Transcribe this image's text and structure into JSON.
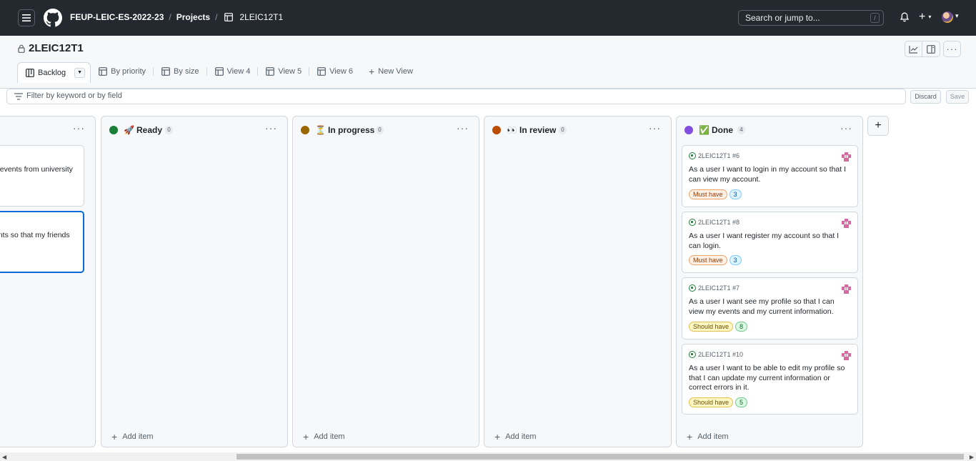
{
  "header": {
    "org": "FEUP-LEIC-ES-2022-23",
    "projects": "Projects",
    "project": "2LEIC12T1",
    "search_placeholder": "Search or jump to...",
    "search_shortcut": "/"
  },
  "project": {
    "title": "2LEIC12T1"
  },
  "tabs": [
    {
      "label": "Backlog"
    },
    {
      "label": "By priority"
    },
    {
      "label": "By size"
    },
    {
      "label": "View 4"
    },
    {
      "label": "View 5"
    },
    {
      "label": "View 6"
    },
    {
      "label": "New View"
    }
  ],
  "filter": {
    "placeholder": "Filter by keyword or by field",
    "discard": "Discard",
    "save": "Save"
  },
  "partial_column": {
    "cards": [
      {
        "title": "e events from university\nd."
      },
      {
        "title": "ents so that my friends"
      }
    ]
  },
  "columns": [
    {
      "name": "Ready",
      "count": "0",
      "color": "#1a7f37",
      "emoji": "🚀",
      "add_label": "Add item"
    },
    {
      "name": "In progress",
      "count": "0",
      "color": "#9a6700",
      "emoji": "⏳",
      "add_label": "Add item"
    },
    {
      "name": "In review",
      "count": "0",
      "color": "#bc4c00",
      "emoji": "👀",
      "add_label": "Add item"
    },
    {
      "name": "Done",
      "count": "4",
      "color": "#8250df",
      "emoji": "✅",
      "add_label": "Add item"
    }
  ],
  "done_cards": [
    {
      "ref": "2LEIC12T1 #6",
      "title": "As a user I want to login in my account so that I can view my account.",
      "priority": "Must have",
      "size": "3"
    },
    {
      "ref": "2LEIC12T1 #8",
      "title": "As a user I want register my account so that I can login.",
      "priority": "Must have",
      "size": "3"
    },
    {
      "ref": "2LEIC12T1 #7",
      "title": "As a user I want see my profile so that I can view my events and my current information.",
      "priority": "Should have",
      "size": "8"
    },
    {
      "ref": "2LEIC12T1 #10",
      "title": "As a user I want to be able to edit my profile so that I can update my current information or correct errors in it.",
      "priority": "Should have",
      "size": "5"
    }
  ],
  "colors": {
    "topbar": "#24292f",
    "accent": "#0969da",
    "must_have": "#fff1e5",
    "should_have": "#fff8c5"
  }
}
